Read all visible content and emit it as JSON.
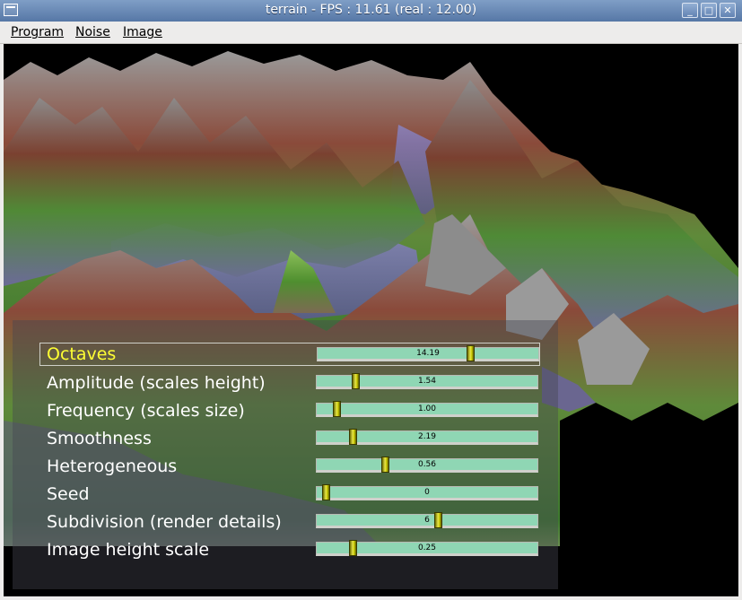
{
  "window": {
    "title": "terrain - FPS : 11.61 (real : 12.00)",
    "buttons": {
      "minimize": "_",
      "maximize": "□",
      "close": "✕"
    }
  },
  "menu": {
    "items": [
      "Program",
      "Noise",
      "Image"
    ]
  },
  "parameters": [
    {
      "label": "Octaves",
      "value": "14.19",
      "fraction": 0.7,
      "active": true
    },
    {
      "label": "Amplitude (scales height)",
      "value": "1.54",
      "fraction": 0.16,
      "active": false
    },
    {
      "label": "Frequency (scales size)",
      "value": "1.00",
      "fraction": 0.07,
      "active": false
    },
    {
      "label": "Smoothness",
      "value": "2.19",
      "fraction": 0.15,
      "active": false
    },
    {
      "label": "Heterogeneous",
      "value": "0.56",
      "fraction": 0.3,
      "active": false
    },
    {
      "label": "Seed",
      "value": "0",
      "fraction": 0.02,
      "active": false
    },
    {
      "label": "Subdivision (render details)",
      "value": "6",
      "fraction": 0.55,
      "active": false
    },
    {
      "label": "Image height scale",
      "value": "0.25",
      "fraction": 0.15,
      "active": false
    }
  ],
  "colors": {
    "active_label": "#ffff33",
    "slider_track": "#8fd6b4",
    "knob": "#d4d200"
  }
}
